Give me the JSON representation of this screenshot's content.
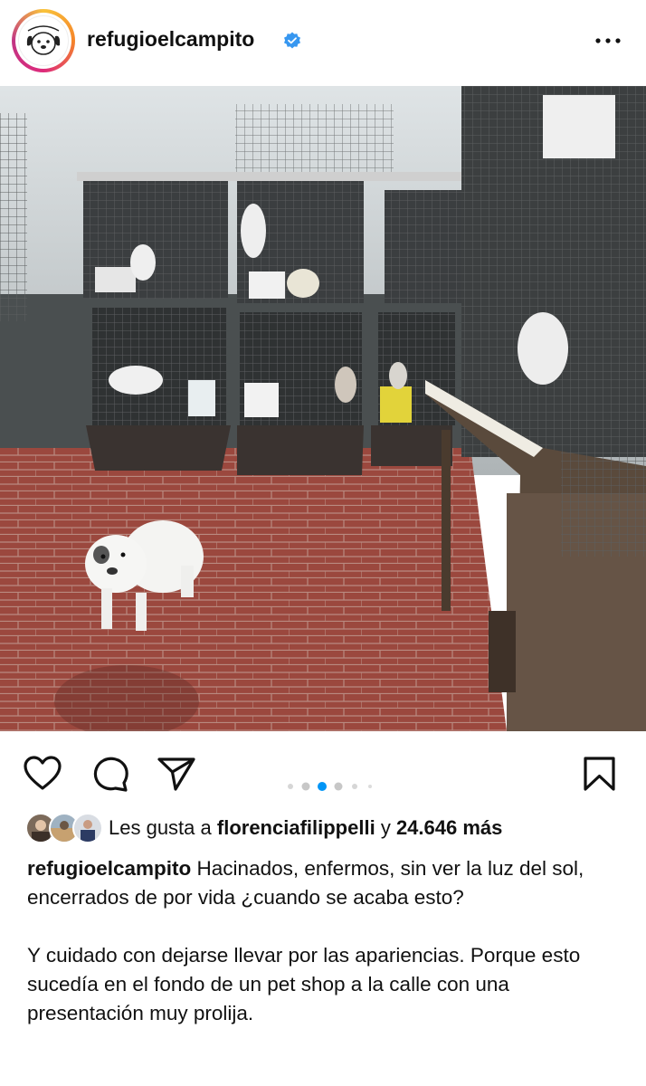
{
  "post": {
    "username": "refugioelcampito",
    "verified": true,
    "avatar_icon": "dog-face-icon",
    "more_icon": "more-horizontal-icon"
  },
  "actions": {
    "like_icon": "heart-icon",
    "comment_icon": "comment-bubble-icon",
    "share_icon": "paper-plane-icon",
    "save_icon": "bookmark-icon",
    "carousel": {
      "count": 6,
      "active_index": 2
    }
  },
  "likes": {
    "prefix": "Les gusta a",
    "liker": "florenciafilippelli",
    "joiner": "y",
    "others": "24.646 más"
  },
  "caption": {
    "username": "refugioelcampito",
    "line1": "Hacinados, enfermos, sin ver la luz del sol, encerrados de por vida ¿cuando se acaba esto?",
    "line2": "Y cuidado con dejarse llevar por las apariencias. Porque esto sucedía en el fondo de un pet shop  a la calle con una presentación muy prolija."
  },
  "colors": {
    "verified_blue": "#3797f0",
    "active_dot": "#0095f6",
    "inactive_dot": "#c7c7c7"
  }
}
